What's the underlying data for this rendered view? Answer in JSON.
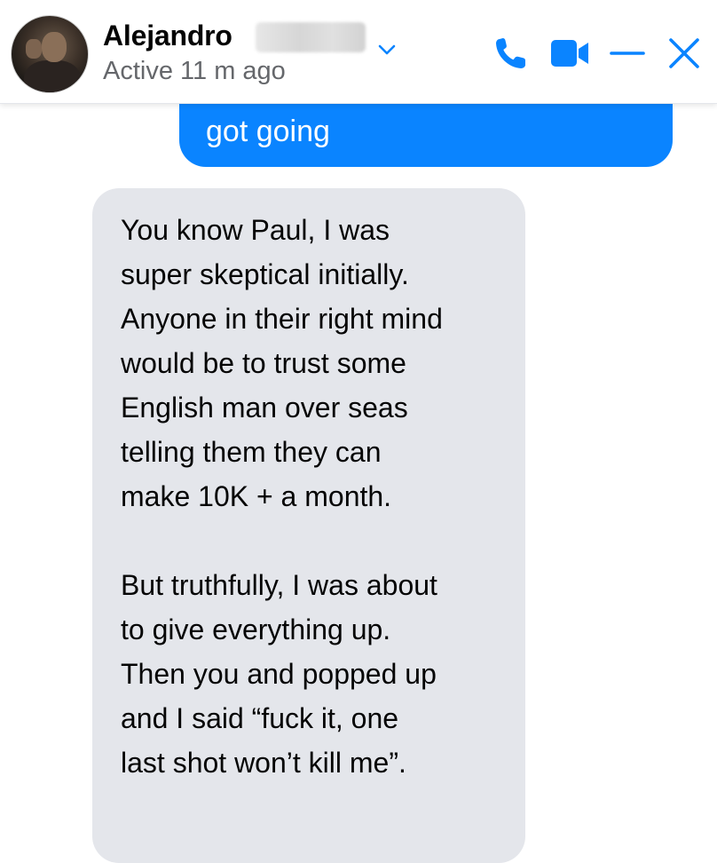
{
  "header": {
    "contact_name": "Alejandro",
    "status": "Active 11 m ago"
  },
  "icons": {
    "dropdown": "chevron-down-icon",
    "call": "phone-icon",
    "video": "video-camera-icon",
    "minimize": "minimize-icon",
    "close": "close-icon"
  },
  "colors": {
    "accent": "#0a84ff",
    "incoming_bubble": "#e4e6eb",
    "secondary_text": "#65676b"
  },
  "messages": {
    "outgoing": {
      "text": "got going"
    },
    "incoming": {
      "lines": [
        "You know Paul, I was",
        "super skeptical initially.",
        "Anyone in their right mind",
        "would be to trust some",
        "English man over seas",
        "telling them they can",
        "make 10K + a month.",
        "",
        "But truthfully, I was about",
        "to give everything up.",
        "Then you and popped up",
        "and I said “fuck it, one",
        "last shot won’t kill me”."
      ]
    }
  }
}
